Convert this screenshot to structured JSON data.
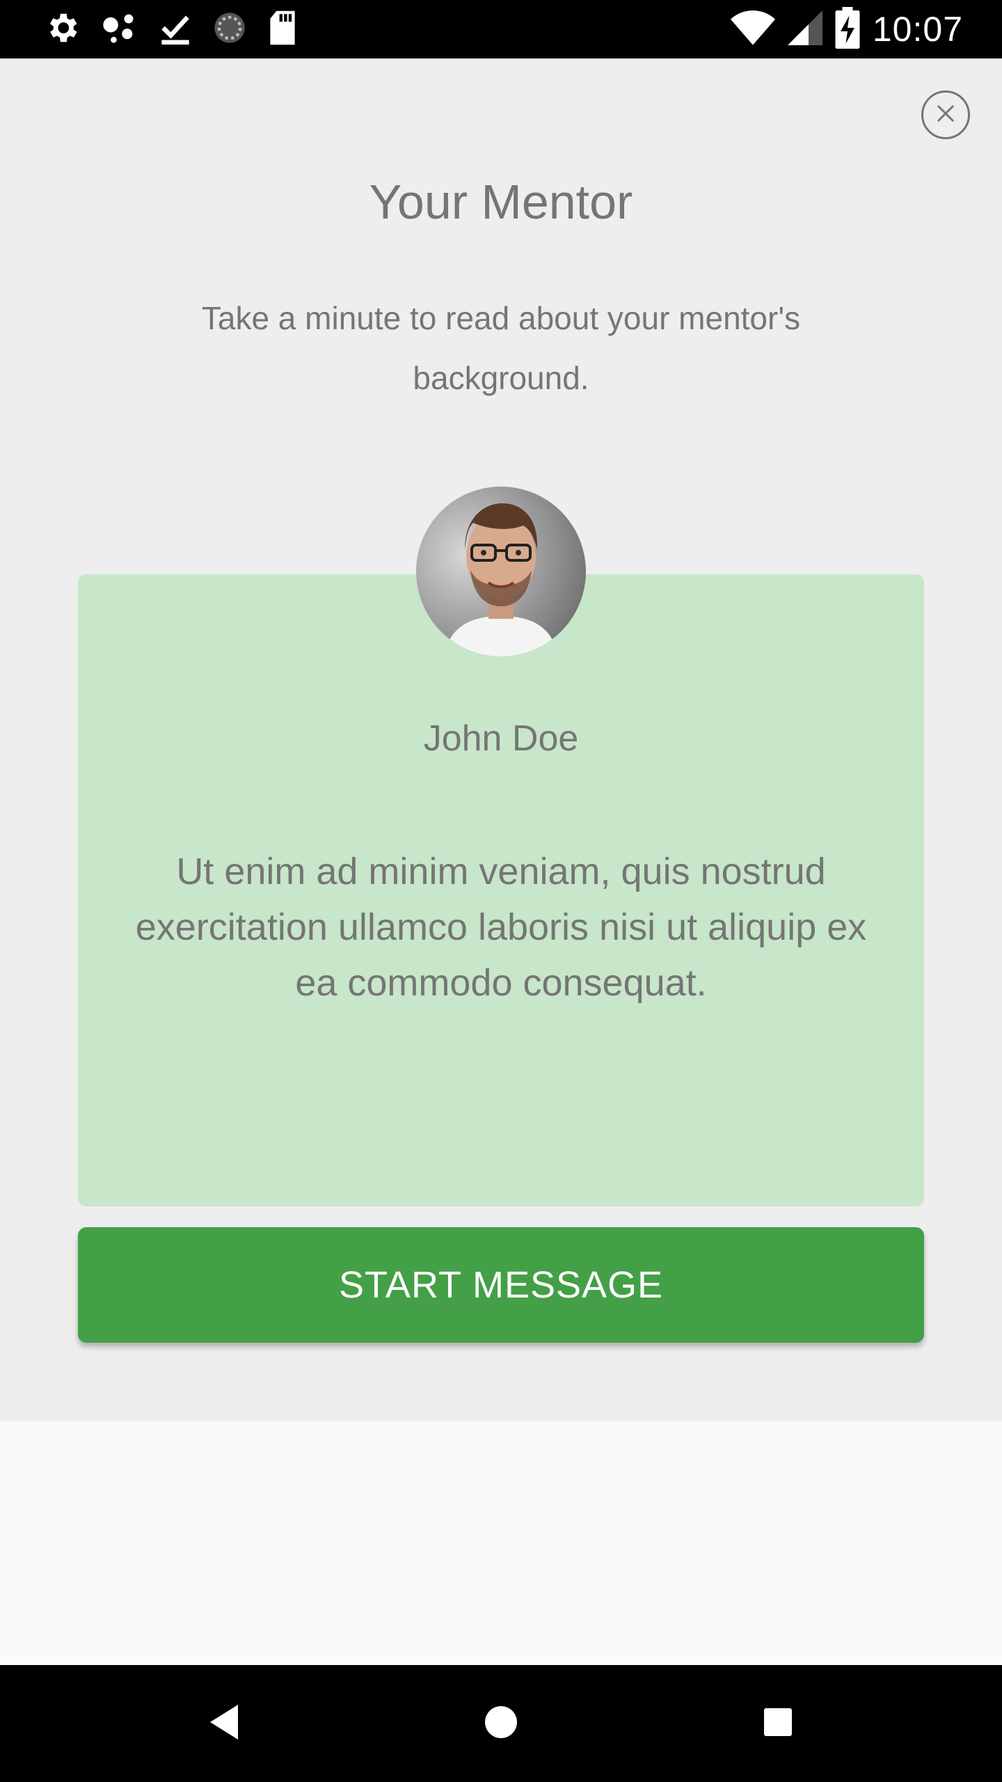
{
  "status_bar": {
    "time": "10:07",
    "left_icons": [
      "settings-icon",
      "assistant-dots-icon",
      "download-done-icon",
      "sync-progress-icon",
      "sd-card-icon"
    ],
    "right_icons": [
      "wifi-icon",
      "cell-signal-icon",
      "battery-charging-icon"
    ]
  },
  "modal": {
    "close_icon": "close-circle-icon",
    "title": "Your Mentor",
    "subtitle": "Take a minute to read about your mentor's background."
  },
  "mentor": {
    "name": "John Doe",
    "bio": "Ut enim ad minim veniam, quis nostrud exercitation ullamco laboris nisi ut aliquip ex ea commodo consequat.",
    "avatar": "mentor-photo"
  },
  "actions": {
    "start_label": "START MESSAGE"
  },
  "nav_bar": {
    "icons": [
      "back-icon",
      "home-icon",
      "recents-icon"
    ]
  },
  "colors": {
    "card_bg": "#c8e6c9",
    "button_bg": "#43a047",
    "modal_bg": "#eeeeee",
    "text": "#757575"
  }
}
